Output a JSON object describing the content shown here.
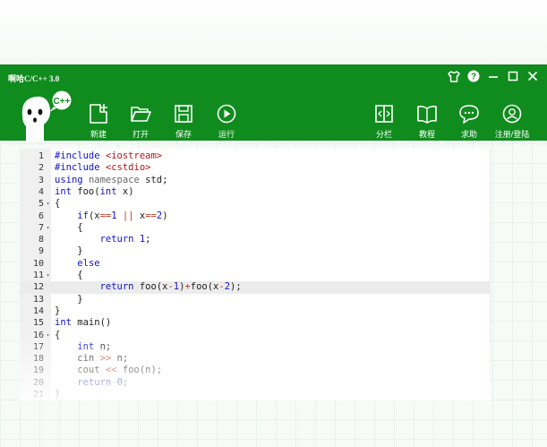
{
  "app": {
    "title": "啊哈C/C++ 3.0",
    "brand_color": "#0f8c1d"
  },
  "window_controls": [
    {
      "name": "skin-icon"
    },
    {
      "name": "help-icon"
    },
    {
      "name": "minimize-icon"
    },
    {
      "name": "maximize-icon"
    },
    {
      "name": "close-icon"
    }
  ],
  "mascot": {
    "badge": "C++"
  },
  "toolbar": {
    "new_label": "新建",
    "open_label": "打开",
    "save_label": "保存",
    "run_label": "运行",
    "split_label": "分栏",
    "tutorial_label": "教程",
    "help_label": "求助",
    "login_label": "注册/登陆"
  },
  "editor": {
    "active_line": 12,
    "lines": [
      {
        "n": "1",
        "text": "#include <iostream>"
      },
      {
        "n": "2",
        "text": "#include <cstdio>"
      },
      {
        "n": "3",
        "text": "using namespace std;"
      },
      {
        "n": "4",
        "text": "int foo(int x)"
      },
      {
        "n": "5",
        "text": "{"
      },
      {
        "n": "6",
        "text": "    if(x==1 || x==2)"
      },
      {
        "n": "7",
        "text": "    {"
      },
      {
        "n": "8",
        "text": "        return 1;"
      },
      {
        "n": "9",
        "text": "    }"
      },
      {
        "n": "10",
        "text": "    else"
      },
      {
        "n": "11",
        "text": "    {"
      },
      {
        "n": "12",
        "text": "        return foo(x-1)+foo(x-2);"
      },
      {
        "n": "13",
        "text": "    }"
      },
      {
        "n": "14",
        "text": "}"
      },
      {
        "n": "15",
        "text": "int main()"
      },
      {
        "n": "16",
        "text": "{"
      },
      {
        "n": "17",
        "text": "    int n;"
      },
      {
        "n": "18",
        "text": "    cin >> n;"
      },
      {
        "n": "19",
        "text": "    cout << foo(n);"
      },
      {
        "n": "20",
        "text": "    return 0;"
      },
      {
        "n": "21",
        "text": "}"
      }
    ]
  }
}
